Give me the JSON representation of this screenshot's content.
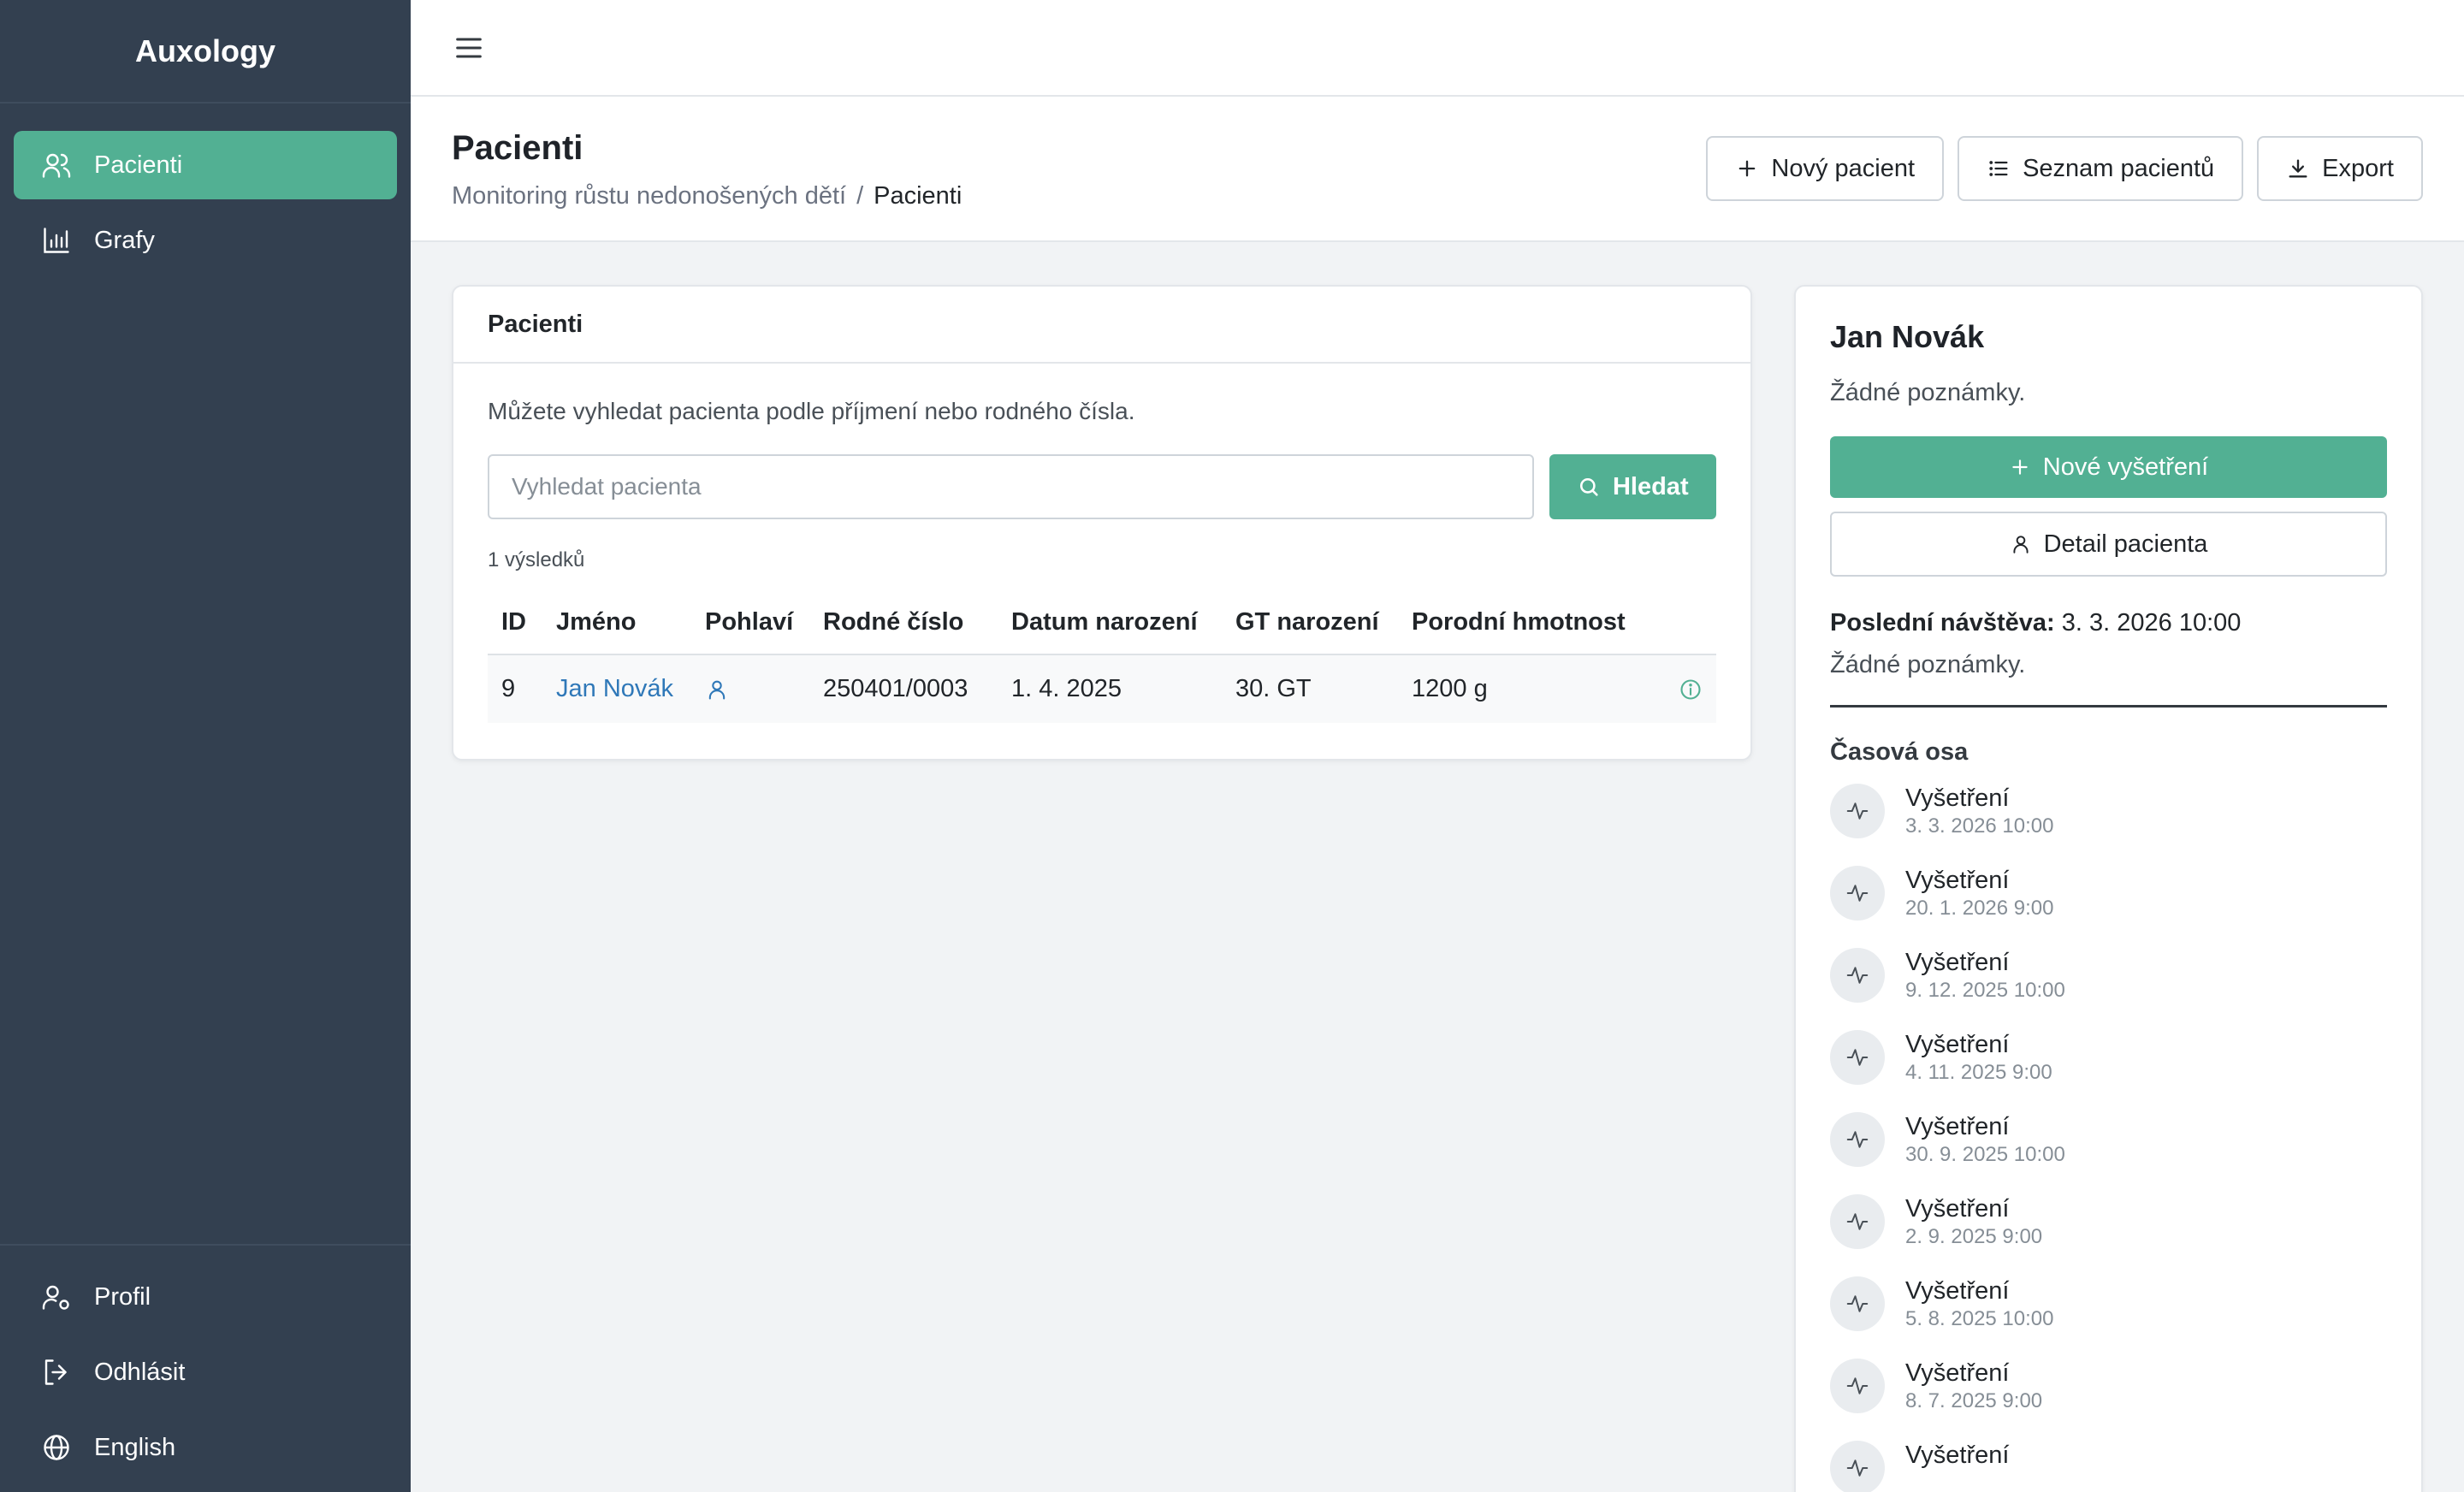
{
  "app": {
    "title": "Auxology"
  },
  "sidebar": {
    "items": [
      {
        "label": "Pacienti",
        "icon": "users-icon",
        "active": true
      },
      {
        "label": "Grafy",
        "icon": "bar-chart-icon",
        "active": false
      }
    ],
    "bottom": [
      {
        "label": "Profil",
        "icon": "user-cog-icon"
      },
      {
        "label": "Odhlásit",
        "icon": "logout-icon"
      },
      {
        "label": "English",
        "icon": "globe-icon"
      }
    ]
  },
  "topbar": {
    "menu_icon": "hamburger-icon"
  },
  "header": {
    "title": "Pacienti",
    "breadcrumb": {
      "parent": "Monitoring růstu nedonošených dětí",
      "separator": "/",
      "current": "Pacienti"
    },
    "actions": {
      "new_patient": "Nový pacient",
      "patient_list": "Seznam pacientů",
      "export": "Export"
    }
  },
  "patients": {
    "card_title": "Pacienti",
    "hint": "Můžete vyhledat pacienta podle příjmení nebo rodného čísla.",
    "search": {
      "placeholder": "Vyhledat pacienta",
      "value": "",
      "button": "Hledat"
    },
    "results_count": "1 výsledků",
    "columns": [
      "ID",
      "Jméno",
      "Pohlaví",
      "Rodné číslo",
      "Datum narození",
      "GT narození",
      "Porodní hmotnost"
    ],
    "rows": [
      {
        "id": "9",
        "name": "Jan Novák",
        "gender_icon": "person-icon",
        "birth_number": "250401/0003",
        "birth_date": "1. 4. 2025",
        "gt": "30. GT",
        "weight": "1200 g",
        "info_icon": "info-icon"
      }
    ]
  },
  "detail": {
    "name": "Jan Novák",
    "notes": "Žádné poznámky.",
    "new_exam_button": "Nové vyšetření",
    "detail_button": "Detail pacienta",
    "last_visit_label": "Poslední návštěva:",
    "last_visit_value": "3. 3. 2026 10:00",
    "last_visit_notes": "Žádné poznámky.",
    "timeline_title": "Časová osa",
    "timeline": [
      {
        "label": "Vyšetření",
        "date": "3. 3. 2026 10:00"
      },
      {
        "label": "Vyšetření",
        "date": "20. 1. 2026 9:00"
      },
      {
        "label": "Vyšetření",
        "date": "9. 12. 2025 10:00"
      },
      {
        "label": "Vyšetření",
        "date": "4. 11. 2025 9:00"
      },
      {
        "label": "Vyšetření",
        "date": "30. 9. 2025 10:00"
      },
      {
        "label": "Vyšetření",
        "date": "2. 9. 2025 9:00"
      },
      {
        "label": "Vyšetření",
        "date": "5. 8. 2025 10:00"
      },
      {
        "label": "Vyšetření",
        "date": "8. 7. 2025 9:00"
      },
      {
        "label": "Vyšetření",
        "date": ""
      }
    ]
  },
  "colors": {
    "sidebar_bg": "#334050",
    "accent": "#52b093",
    "link": "#2f78b8"
  }
}
